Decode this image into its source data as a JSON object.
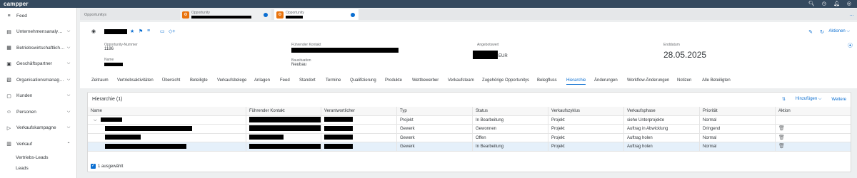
{
  "shell": {
    "logo": "campper"
  },
  "sidebar": {
    "items": [
      {
        "label": "Feed",
        "icon": "feed-icon",
        "chevron": ""
      },
      {
        "label": "Unternehmensanaly…",
        "icon": "analytics-icon",
        "chevron": "⌄"
      },
      {
        "label": "Betriebswirtschaftlich…",
        "icon": "business-icon",
        "chevron": "⌄"
      },
      {
        "label": "Geschäftspartner",
        "icon": "partner-icon",
        "chevron": "⌄"
      },
      {
        "label": "Organisationsmanag…",
        "icon": "organization-icon",
        "chevron": "⌄"
      },
      {
        "label": "Kunden",
        "icon": "customer-icon",
        "chevron": "⌄"
      },
      {
        "label": "Personen",
        "icon": "person-icon",
        "chevron": "⌄"
      },
      {
        "label": "Verkaufskampagne",
        "icon": "campaign-icon",
        "chevron": "⌄"
      },
      {
        "label": "Verkauf",
        "icon": "sales-icon",
        "chevron": "⌃"
      }
    ],
    "subitems": [
      "Vertriebs-Leads",
      "Leads"
    ]
  },
  "tabs": {
    "plain_label": "Opportunitys",
    "tab1_title": "Opportunity",
    "tab2_title": "Opportunity"
  },
  "header": {
    "fields": {
      "opp_number_label": "Opportunity-Nummer",
      "opp_number_value": "1186",
      "name_label": "Name",
      "lead_contact_label": "Führender Kontakt",
      "construction_label": "Bausituation",
      "construction_value": "Neubau",
      "offer_value_label": "Angebotswert",
      "offer_currency": "EUR",
      "end_date_label": "Enddatum",
      "end_date_value": "28.05.2025"
    },
    "actions_label": "Aktionen",
    "subtabs": [
      "Zeitraum",
      "Vertriebsaktivitäten",
      "Übersicht",
      "Beteiligte",
      "Verkaufsbelege",
      "Anlagen",
      "Feed",
      "Standort",
      "Termine",
      "Qualifizierung",
      "Produkte",
      "Wettbewerber",
      "Verkaufsteam",
      "Zugehörige Opportunitys",
      "Belegfluss",
      "Hierarchie",
      "Änderungen",
      "Workflow-Änderungen",
      "Notizen",
      "Alle Beteiligten"
    ],
    "active_subtab": "Hierarchie"
  },
  "panel": {
    "title": "Hierarchie",
    "count": "(1)",
    "add_label": "Hinzufügen",
    "more_label": "Weitere",
    "columns": [
      "Name",
      "Führender Kontakt",
      "Verantwortlicher",
      "Typ",
      "Status",
      "Verkaufszyklus",
      "Verkaufsphase",
      "Priorität",
      "Aktion"
    ],
    "rows": [
      {
        "typ": "Projekt",
        "status": "In Bearbeitung",
        "zyklus": "Projekt",
        "phase": "siehe Unterprojekte",
        "prio": "Normal",
        "trash": false
      },
      {
        "typ": "Gewerk",
        "status": "Gewonnen",
        "zyklus": "Projekt",
        "phase": "Auftrag in Abwicklung",
        "prio": "Dringend",
        "trash": true
      },
      {
        "typ": "Gewerk",
        "status": "Offen",
        "zyklus": "Projekt",
        "phase": "Auftrag holen",
        "prio": "Normal",
        "trash": true
      },
      {
        "typ": "Gewerk",
        "status": "In Bearbeitung",
        "zyklus": "Projekt",
        "phase": "Auftrag holen",
        "prio": "Normal",
        "trash": true
      }
    ],
    "selected_text": "1 ausgewählt"
  },
  "colors": {
    "shell": "#354a5f",
    "accent": "#0a6ed1",
    "tab_icon": "#e9730c"
  }
}
